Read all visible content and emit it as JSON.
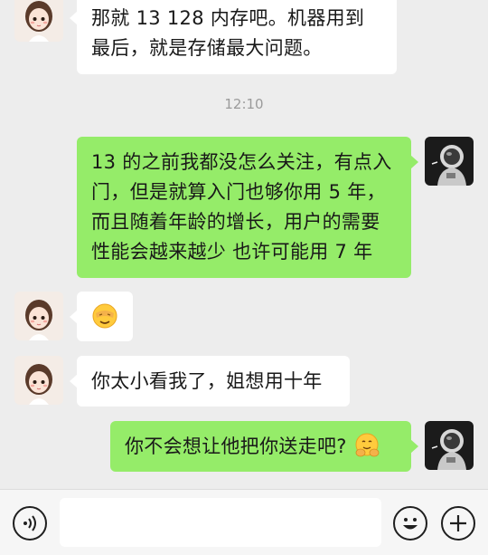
{
  "messages": [
    {
      "side": "left",
      "text": "那就 13 128 内存吧。机器用到最后，就是存储最大问题。"
    },
    {
      "side": "right",
      "text": "13 的之前我都没怎么关注，有点入门，但是就算入门也够你用 5 年，而且随着年龄的增长，用户的需要性能会越来越少 也许可能用 7 年"
    },
    {
      "side": "left",
      "emoji": "face-with-hand-over-eyes-icon"
    },
    {
      "side": "left",
      "text": "你太小看我了，姐想用十年"
    },
    {
      "side": "right",
      "text": "你不会想让他把你送走吧?",
      "emoji": "hugging-face-icon"
    }
  ],
  "timestamp": "12:10",
  "input": {
    "value": ""
  },
  "colors": {
    "background": "#ededed",
    "self_bubble": "#95ec69",
    "other_bubble": "#ffffff",
    "timestamp": "#9b9b9b"
  },
  "icons": {
    "voice": "voice-icon",
    "emoji": "smiley-icon",
    "more": "plus-icon"
  }
}
